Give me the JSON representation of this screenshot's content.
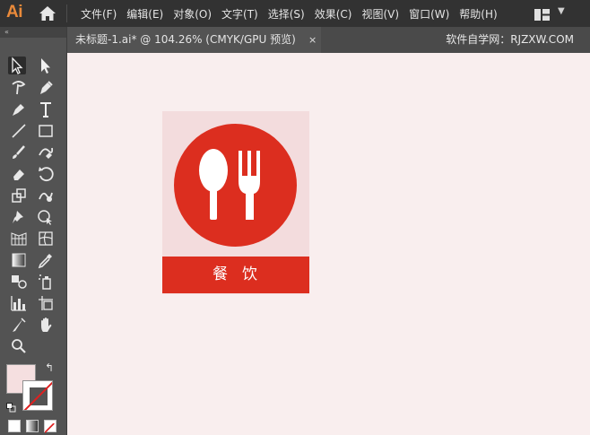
{
  "app": {
    "logo": "Ai"
  },
  "menu": [
    "文件(F)",
    "编辑(E)",
    "对象(O)",
    "文字(T)",
    "选择(S)",
    "效果(C)",
    "视图(V)",
    "窗口(W)",
    "帮助(H)"
  ],
  "toolbar": {
    "collapse_glyph": "«"
  },
  "document_tab": {
    "title": "未标题-1.ai* @ 104.26% (CMYK/GPU 预览)",
    "close_glyph": "×"
  },
  "watermark": "软件自学网：RJZXW.COM",
  "artwork": {
    "banner_text": "餐饮",
    "accent_color": "#dc2e1f",
    "background_color": "#f3dcdd"
  },
  "colors": {
    "fill": "#f5dfe0",
    "stroke": "none"
  }
}
